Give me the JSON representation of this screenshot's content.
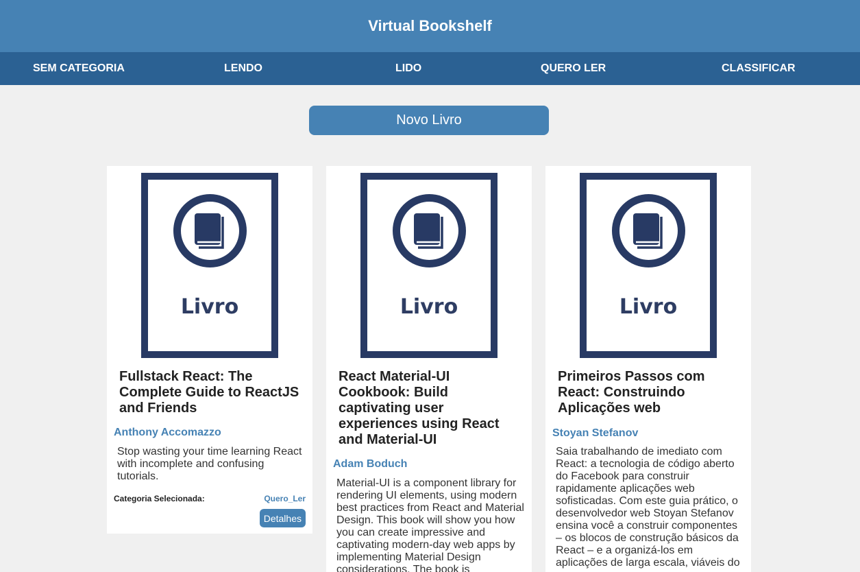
{
  "header": {
    "title": "Virtual Bookshelf"
  },
  "nav": [
    {
      "label": "SEM CATEGORIA"
    },
    {
      "label": "LENDO"
    },
    {
      "label": "LIDO"
    },
    {
      "label": "QUERO LER"
    },
    {
      "label": "CLASSIFICAR"
    }
  ],
  "new_book_button": "Novo Livro",
  "books": [
    {
      "cover_text": "Livro",
      "title": "Fullstack React: The Complete Guide to ReactJS and Friends",
      "author": "Anthony Accomazzo",
      "description": "Stop wasting your time learning React with incomplete and confusing tutorials.",
      "category_label": "Categoria Selecionada:",
      "category": "Quero_Ler",
      "details_label": "Detalhes"
    },
    {
      "cover_text": "Livro",
      "title": "React Material-UI Cookbook: Build captivating user experiences using React and Material-UI",
      "author": "Adam Boduch",
      "description": "Material-UI is a component library for rendering UI elements, using modern best practices from React and Material Design. This book will show you how you can create impressive and captivating modern-day web apps by implementing Material Design considerations. The book is"
    },
    {
      "cover_text": "Livro",
      "title": "Primeiros Passos com React: Construindo Aplicações web",
      "author": "Stoyan Stefanov",
      "description": "Saia trabalhando de imediato com React: a tecnologia de código aberto do Facebook para construir rapidamente aplicações web sofisticadas. Com este guia prático, o desenvolvedor web Stoyan Stefanov ensina você a construir componentes – os blocos de construção básicos da React – e a organizá-los em aplicações de larga escala, viáveis do"
    }
  ],
  "colors": {
    "header": "#4682b4",
    "nav": "#2b6193",
    "cover": "#283a64",
    "accent": "#4682b4"
  }
}
